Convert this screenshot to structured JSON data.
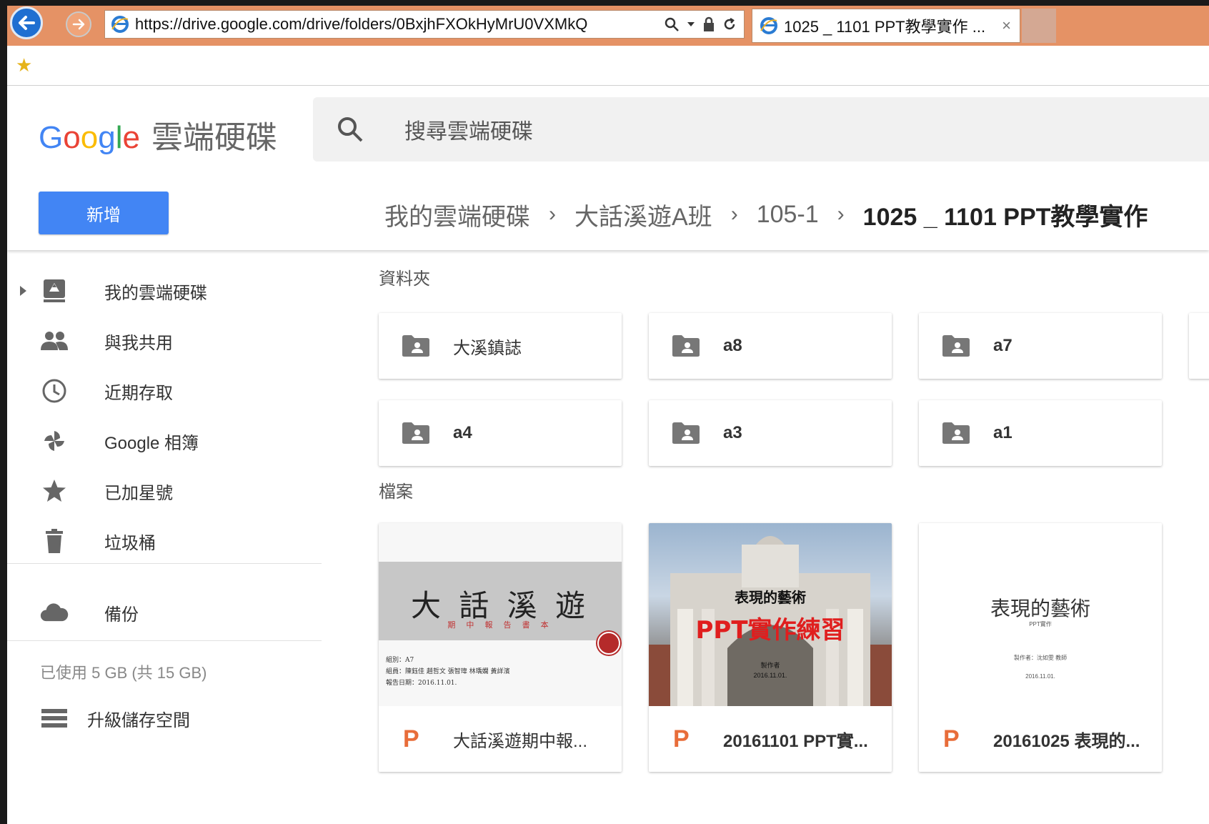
{
  "browser": {
    "url": "https://drive.google.com/drive/folders/0BxjhFXOkHyMrU0VXMkQ",
    "tab_title": "1025 _ 1101 PPT教學實作 ...",
    "tab_close": "×"
  },
  "drive": {
    "logo_text": [
      "G",
      "o",
      "o",
      "g",
      "l",
      "e"
    ],
    "product_name": "雲端硬碟",
    "search_placeholder": "搜尋雲端硬碟",
    "new_button": "新增",
    "breadcrumb": [
      "我的雲端硬碟",
      "大話溪遊A班",
      "105-1",
      "1025 _ 1101 PPT教學實作"
    ],
    "breadcrumb_sep": "›"
  },
  "sidebar": {
    "items": [
      {
        "label": "我的雲端硬碟",
        "icon": "drive-icon"
      },
      {
        "label": "與我共用",
        "icon": "people-icon"
      },
      {
        "label": "近期存取",
        "icon": "clock-icon"
      },
      {
        "label": "Google 相簿",
        "icon": "pinwheel-icon"
      },
      {
        "label": "已加星號",
        "icon": "star-icon"
      },
      {
        "label": "垃圾桶",
        "icon": "trash-icon"
      },
      {
        "label": "備份",
        "icon": "cloud-icon"
      }
    ],
    "storage_text": "已使用 5 GB (共 15 GB)",
    "upgrade_label": "升級儲存空間"
  },
  "content": {
    "folders_heading": "資料夾",
    "files_heading": "檔案",
    "folders": [
      "大溪鎮誌",
      "a8",
      "a7",
      "a4",
      "a3",
      "a1"
    ],
    "files": [
      {
        "name": "大話溪遊期中報...",
        "thumb_title": "大 話 溪 遊",
        "thumb_sub": "期 中 報 告 書 本",
        "thumb_lines": [
          "組別：A7",
          "組員：陳鈺佳 趙哲文 張智瑋 林瑀嫻 黃詳濱",
          "報告日期：2016.11.01."
        ]
      },
      {
        "name": "20161101 PPT實...",
        "thumb_title": "表現的藝術",
        "thumb_sub": "PPT實作練習",
        "thumb_lines": [
          "製作者",
          "2016.11.01."
        ]
      },
      {
        "name": "20161025 表現的...",
        "thumb_title": "表現的藝術",
        "thumb_sub": "PPT實作",
        "thumb_lines": [
          "製作者：沈如雯 教師",
          "2016.11.01."
        ]
      }
    ],
    "file_type_letter": "P"
  },
  "colors": {
    "drive_blue": "#4285f4",
    "titlebar": "#e59265",
    "ppt_orange": "#e86d3a"
  }
}
